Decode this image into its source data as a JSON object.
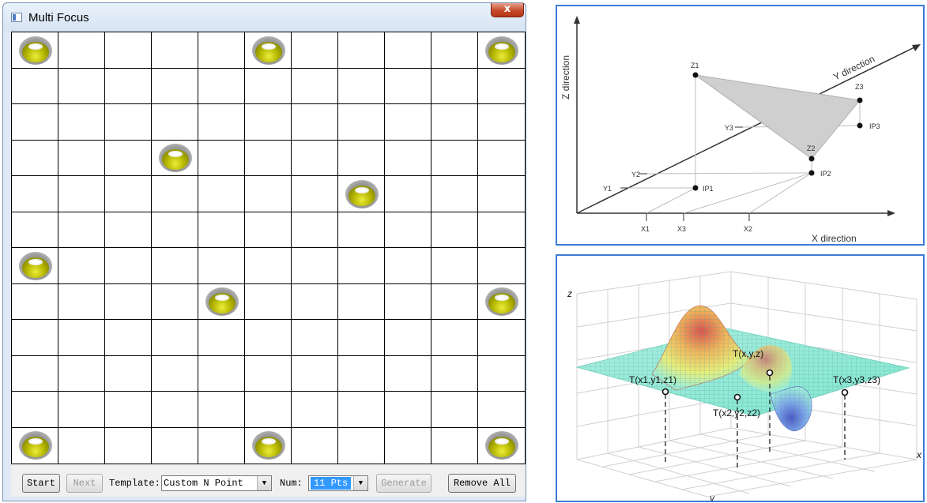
{
  "window": {
    "title": "Multi Focus",
    "close_label": "x"
  },
  "grid": {
    "rows": 12,
    "cols": 11,
    "focus_points": [
      {
        "row": 0,
        "col": 0
      },
      {
        "row": 0,
        "col": 5
      },
      {
        "row": 0,
        "col": 10
      },
      {
        "row": 3,
        "col": 3
      },
      {
        "row": 4,
        "col": 7
      },
      {
        "row": 6,
        "col": 0
      },
      {
        "row": 7,
        "col": 4
      },
      {
        "row": 7,
        "col": 10
      },
      {
        "row": 11,
        "col": 0
      },
      {
        "row": 11,
        "col": 5
      },
      {
        "row": 11,
        "col": 10
      }
    ]
  },
  "toolbar": {
    "start_label": "Start",
    "next_label": "Next",
    "template_label": "Template:",
    "template_value": "Custom N Point",
    "num_label": "Num:",
    "num_value": "11 Pts",
    "generate_label": "Generate",
    "remove_all_label": "Remove All"
  },
  "plane_diagram": {
    "z_axis": "Z direction",
    "y_axis": "Y direction",
    "x_axis": "X direction",
    "points": {
      "z1": "Z1",
      "z2": "Z2",
      "z3": "Z3",
      "ip1": "IP1",
      "ip2": "IP2",
      "ip3": "IP3",
      "y1": "Y1",
      "y2": "Y2",
      "y3": "Y3",
      "x1": "X1",
      "x2": "X2",
      "x3": "X3"
    }
  },
  "surface_diagram": {
    "z_axis": "z",
    "x_axis": "x",
    "y_axis": "y",
    "points": {
      "t1": "T(x1,y1,z1)",
      "t2": "T(x2,y2,z2)",
      "t3": "T(x3,y3,z3)",
      "t": "T(x,y,z)"
    }
  }
}
